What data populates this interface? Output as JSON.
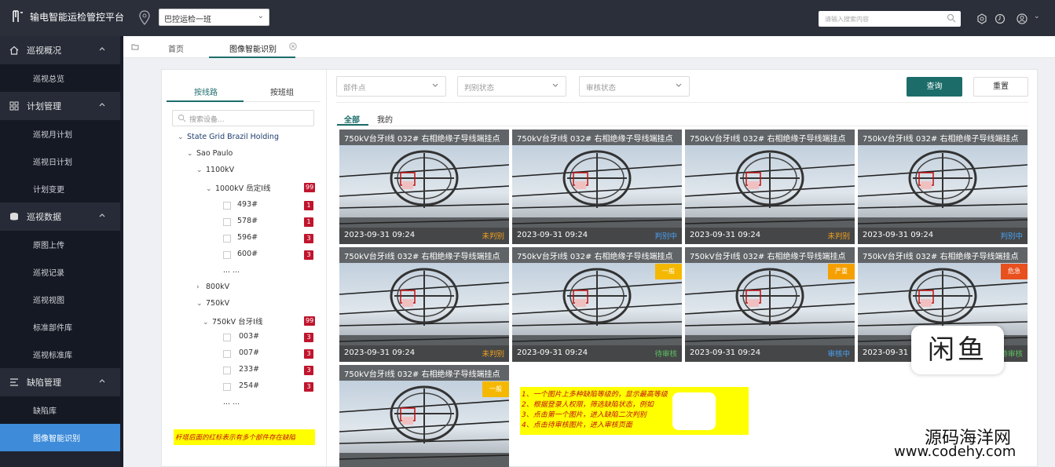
{
  "app": {
    "title": "输电智能运检管控平台",
    "org_select": "巴控运检一班",
    "search_placeholder": "请输入搜索内容"
  },
  "icons": {
    "logo": "tower-icon",
    "location": "location-pin-icon",
    "search": "search-icon",
    "settings": "settings-icon",
    "refresh": "refresh-icon",
    "user": "user-icon"
  },
  "sidebar": {
    "groups": [
      {
        "label": "巡视概况",
        "icon": "home-icon",
        "items": [
          "巡视总览"
        ]
      },
      {
        "label": "计划管理",
        "icon": "grid-icon",
        "items": [
          "巡视月计划",
          "巡视日计划",
          "计划变更"
        ]
      },
      {
        "label": "巡视数据",
        "icon": "database-icon",
        "items": [
          "原图上传",
          "巡视记录",
          "巡视视图",
          "标准部件库",
          "巡视标准库"
        ]
      },
      {
        "label": "缺陷管理",
        "icon": "list-icon",
        "items": [
          "缺陷库",
          "图像智能识别"
        ]
      }
    ],
    "active_item": "图像智能识别"
  },
  "tabs": {
    "items": [
      "首页",
      "图像智能识别"
    ],
    "active": "图像智能识别"
  },
  "tree": {
    "tab_line": "按线路",
    "tab_team": "按班组",
    "search_placeholder": "搜索设备...",
    "nodes": {
      "root": "State Grid Brazil Holding",
      "region": "Sao Paulo",
      "v1100": "1100kV",
      "line1": "1000kV 岳定Ⅰ线",
      "line1_badge": "99",
      "t493": "493#",
      "t493_badge": "1",
      "t578": "578#",
      "t578_badge": "1",
      "t596": "596#",
      "t596_badge": "3",
      "t600": "600#",
      "t600_badge": "3",
      "more1": "... ...",
      "v800": "800kV",
      "v750": "750kV",
      "line2": "750kV 台牙Ⅰ线",
      "line2_badge": "99",
      "t003": "003#",
      "t003_badge": "3",
      "t007": "007#",
      "t007_badge": "3",
      "t233": "233#",
      "t233_badge": "3",
      "t254": "254#",
      "t254_badge": "3",
      "more2": "... ..."
    },
    "note": "杆塔后面的红标表示有多个部件存在缺陷"
  },
  "filters": {
    "component": "部件点",
    "judge_status": "判别状态",
    "review_status": "审核状态",
    "query_button": "查询",
    "reset_button": "重置"
  },
  "subtabs": {
    "all": "全部",
    "mine": "我的"
  },
  "cards": [
    {
      "title": "750kV台牙Ⅰ线 032# 右相绝缘子导线端挂点",
      "time": "2023-09-31 09:24",
      "status": "未判别",
      "status_color": "#f0a020",
      "tag": "",
      "tag_color": ""
    },
    {
      "title": "750kV台牙Ⅰ线 032# 右相绝缘子导线端挂点",
      "time": "2023-09-31 09:24",
      "status": "判别中",
      "status_color": "#4aa0f0",
      "tag": "",
      "tag_color": ""
    },
    {
      "title": "750kV台牙Ⅰ线 032# 右相绝缘子导线端挂点",
      "time": "2023-09-31 09:24",
      "status": "未判别",
      "status_color": "#f0a020",
      "tag": "",
      "tag_color": ""
    },
    {
      "title": "750kV台牙Ⅰ线 032# 右相绝缘子导线端挂点",
      "time": "2023-09-31 09:24",
      "status": "判别中",
      "status_color": "#4aa0f0",
      "tag": "",
      "tag_color": ""
    },
    {
      "title": "750kV台牙Ⅰ线 032# 右相绝缘子导线端挂点",
      "time": "2023-09-31 09:24",
      "status": "未判别",
      "status_color": "#f0a020",
      "tag": "",
      "tag_color": ""
    },
    {
      "title": "750kV台牙Ⅰ线 032# 右相绝缘子导线端挂点",
      "time": "2023-09-31 09:24",
      "status": "待审核",
      "status_color": "#5cc060",
      "tag": "一般",
      "tag_color": "#f5b800"
    },
    {
      "title": "750kV台牙Ⅰ线 032# 右相绝缘子导线端挂点",
      "time": "2023-09-31 09:24",
      "status": "审核中",
      "status_color": "#4aa0f0",
      "tag": "严重",
      "tag_color": "#f5a000"
    },
    {
      "title": "750kV台牙Ⅰ线 032# 右相绝缘子导线端挂点",
      "time": "2023-09-31 09:24",
      "status": "待审核",
      "status_color": "#5cc060",
      "tag": "危急",
      "tag_color": "#e8501e"
    },
    {
      "title": "750kV台牙Ⅰ线 032# 右相绝缘子导线端挂点",
      "time": "",
      "status": "",
      "status_color": "",
      "tag": "一般",
      "tag_color": "#f5b800"
    }
  ],
  "notes": [
    "1、一个图片上多种缺陷等级的，显示最高等级",
    "2、根据登录人权限，筛选缺陷状态，例如",
    "3、点击第一个图片，进入缺陷二次判别",
    "4、点击待审核图片，进入审核页面"
  ],
  "watermark": {
    "logo_text": "闲鱼",
    "site_cn": "源码海洋网",
    "site_url": "www.codehy.com"
  },
  "colors": {
    "primary": "#1c6d6a",
    "sidebar": "#1f2430",
    "active": "#3d8bd9",
    "badge": "#c0152e",
    "highlight": "#ffff00"
  }
}
